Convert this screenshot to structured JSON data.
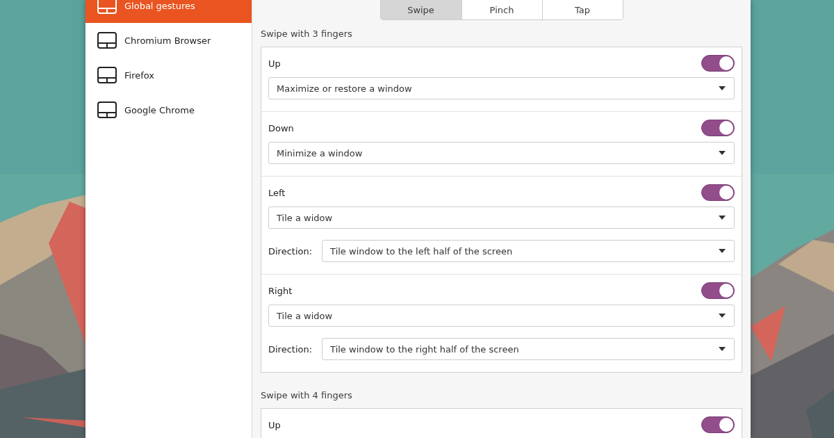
{
  "sidebar": {
    "items": [
      {
        "label": "Global gestures",
        "selected": true
      },
      {
        "label": "Chromium Browser",
        "selected": false
      },
      {
        "label": "Firefox",
        "selected": false
      },
      {
        "label": "Google Chrome",
        "selected": false
      }
    ]
  },
  "tabs": [
    {
      "label": "Swipe",
      "selected": true
    },
    {
      "label": "Pinch",
      "selected": false
    },
    {
      "label": "Tap",
      "selected": false
    }
  ],
  "sections": [
    {
      "title": "Swipe with 3 fingers",
      "rows": [
        {
          "label": "Up",
          "on": true,
          "action": "Maximize or restore a window"
        },
        {
          "label": "Down",
          "on": true,
          "action": "Minimize a window"
        },
        {
          "label": "Left",
          "on": true,
          "action": "Tile a widow",
          "direction": {
            "label": "Direction:",
            "value": "Tile window to the left half of the screen"
          }
        },
        {
          "label": "Right",
          "on": true,
          "action": "Tile a widow",
          "direction": {
            "label": "Direction:",
            "value": "Tile window to the right half of the screen"
          }
        }
      ]
    },
    {
      "title": "Swipe with 4 fingers",
      "rows": [
        {
          "label": "Up",
          "on": true
        }
      ]
    }
  ]
}
